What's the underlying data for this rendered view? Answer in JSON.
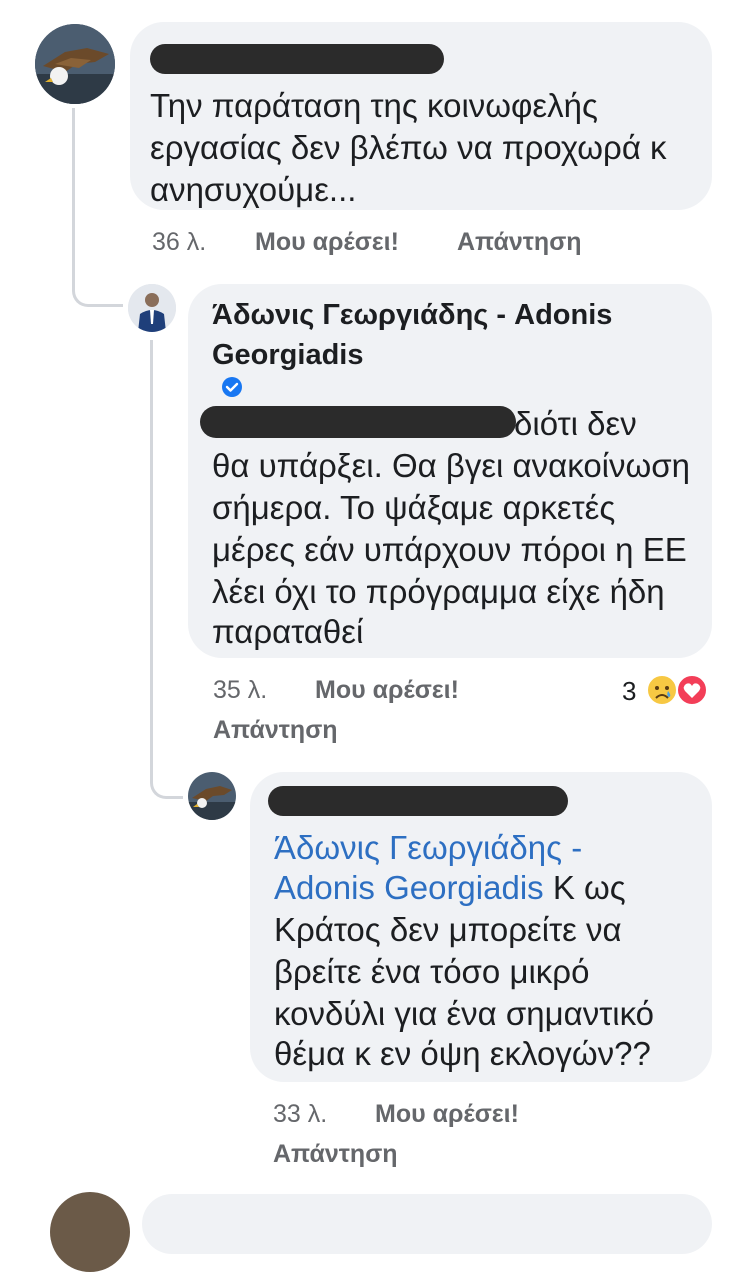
{
  "comments": [
    {
      "text_lines": [
        "Την παράταση της κοινωφελής",
        "εργασίας δεν βλέπω να προχωρά κ",
        "ανησυχούμε..."
      ],
      "time": "36 λ.",
      "like_label": "Μου αρέσει!",
      "reply_label": "Απάντηση"
    },
    {
      "author_line1": "Άδωνις Γεωργιάδης - Adonis",
      "author_line2": "Georgiadis",
      "verified_icon": "verified-badge",
      "first_line_tail": "διότι δεν",
      "text_lines": [
        "θα υπάρξει. Θα βγει ανακοίνωση",
        "σήμερα. Το ψάξαμε αρκετές",
        "μέρες εάν υπάρχουν πόροι η ΕΕ",
        "λέει όχι το πρόγραμμα είχε ήδη",
        "παραταθεί"
      ],
      "time": "35 λ.",
      "like_label": "Μου αρέσει!",
      "reply_label": "Απάντηση",
      "reaction_count": "3",
      "reactions": [
        "sad-emoji",
        "love-heart"
      ]
    },
    {
      "mention_line1": "Άδωνις Γεωργιάδης -",
      "mention_line2": "Adonis Georgiadis",
      "line2_tail": " Κ ως",
      "text_lines": [
        "Κράτος δεν μπορείτε να",
        "βρείτε ένα τόσο μικρό",
        "κονδύλι για ένα σημαντικό",
        "θέμα κ εν όψη εκλογών??"
      ],
      "time": "33 λ.",
      "like_label": "Μου αρέσει!",
      "reply_label": "Απάντηση"
    }
  ],
  "colors": {
    "bubble": "#f0f2f5",
    "meta": "#65676b",
    "mention": "#2d6fc2",
    "verified": "#1877f2",
    "redaction": "#2b2b2b"
  }
}
